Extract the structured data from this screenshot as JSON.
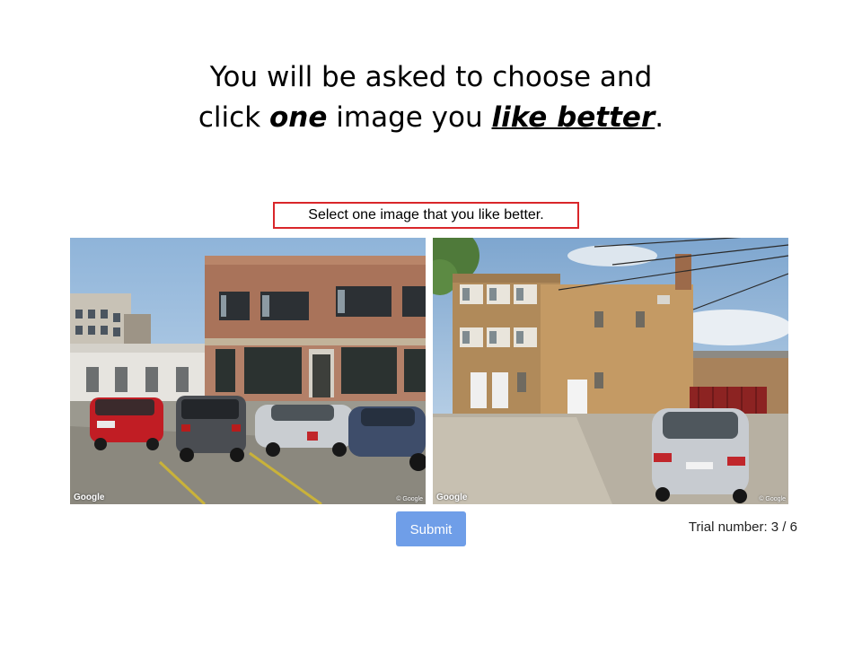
{
  "heading": {
    "line1": "You will be asked to choose and",
    "line2_a": "click ",
    "line2_b": "one",
    "line2_c": " image you ",
    "line2_d": "like better",
    "line2_e": "."
  },
  "prompt": {
    "text": "Select one image that you like better."
  },
  "images": [
    {
      "watermark": "Google",
      "copyright": "© Google"
    },
    {
      "watermark": "Google",
      "copyright": "© Google"
    }
  ],
  "submit": {
    "label": "Submit"
  },
  "trial": {
    "label": "Trial number:",
    "current": "3",
    "separator": " / ",
    "total": "6"
  },
  "colors": {
    "accent": "#6f9ee8",
    "prompt_border": "#d9262a"
  }
}
